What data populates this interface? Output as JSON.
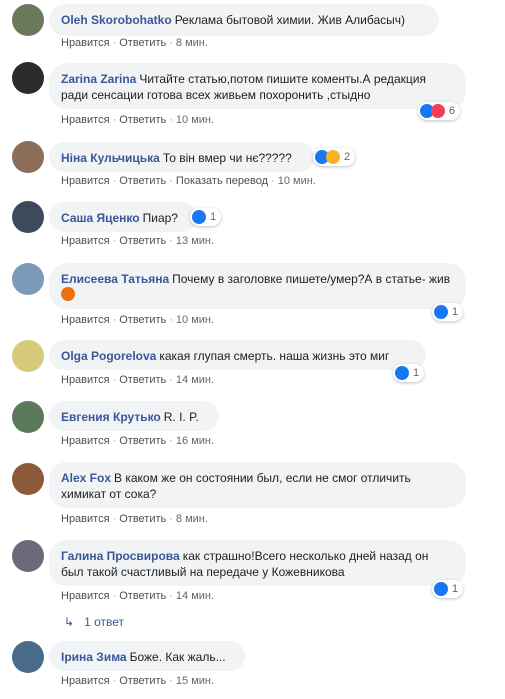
{
  "comments": [
    {
      "author": "Oleh Skorobohatko",
      "text": "Реклама бытовой химии. Жив Алибасыч)",
      "like": "Нравится",
      "reply": "Ответить",
      "time": "8 мин.",
      "avatar_color": "#6b7a5a"
    },
    {
      "author": "Zarina Zarina",
      "text": "Читайте статью,потом пишите коменты.А редакция ради сенсации готова всех живьем похоронить ,стыдно",
      "like": "Нравится",
      "reply": "Ответить",
      "time": "10 мин.",
      "reactions": [
        "like",
        "heart"
      ],
      "reaction_count": "6",
      "avatar_color": "#2c2c2c"
    },
    {
      "author": "Ніна Кульчицька",
      "text": "То він вмер чи нє?????",
      "like": "Нравится",
      "reply": "Ответить",
      "translate": "Показать перевод",
      "time": "10 мин.",
      "reactions": [
        "like",
        "haha"
      ],
      "reaction_count": "2",
      "avatar_color": "#8a6e5a"
    },
    {
      "author": "Саша Яценко",
      "text": "Пиар?",
      "like": "Нравится",
      "reply": "Ответить",
      "time": "13 мин.",
      "reactions": [
        "like"
      ],
      "reaction_count": "1",
      "avatar_color": "#3d4a5c"
    },
    {
      "author": "Елисеева Татьяна",
      "text": "Почему в заголовке пишете/умер?А в статье- жив",
      "emoji": "angry-face",
      "like": "Нравится",
      "reply": "Ответить",
      "time": "10 мин.",
      "reactions": [
        "like"
      ],
      "reaction_count": "1",
      "avatar_color": "#7a9ab8"
    },
    {
      "author": "Olga Pogorelova",
      "text": "какая глупая смерть. наша жизнь это миг",
      "like": "Нравится",
      "reply": "Ответить",
      "time": "14 мин.",
      "reactions": [
        "like"
      ],
      "reaction_count": "1",
      "avatar_color": "#d6c97a"
    },
    {
      "author": "Евгения Крутько",
      "text": "R. I. P.",
      "like": "Нравится",
      "reply": "Ответить",
      "time": "16 мин.",
      "avatar_color": "#5a7a5a"
    },
    {
      "author": "Alex Fox",
      "text": "В каком же он состоянии был, если не смог отличить химикат от сока?",
      "like": "Нравится",
      "reply": "Ответить",
      "time": "8 мин.",
      "avatar_color": "#8a5a3a"
    },
    {
      "author": "Галина Просвирова",
      "text": "как страшно!Всего несколько дней назад он был такой счастливый на передаче у Кожевникова",
      "like": "Нравится",
      "reply": "Ответить",
      "time": "14 мин.",
      "reactions": [
        "like"
      ],
      "reaction_count": "1",
      "avatar_color": "#6a6a7a"
    },
    {
      "author": "Ірина Зима",
      "text": "Боже. Как жаль...",
      "like": "Нравится",
      "reply": "Ответить",
      "time": "15 мин.",
      "avatar_color": "#4a6a8a"
    }
  ],
  "replies_label": "1 ответ"
}
